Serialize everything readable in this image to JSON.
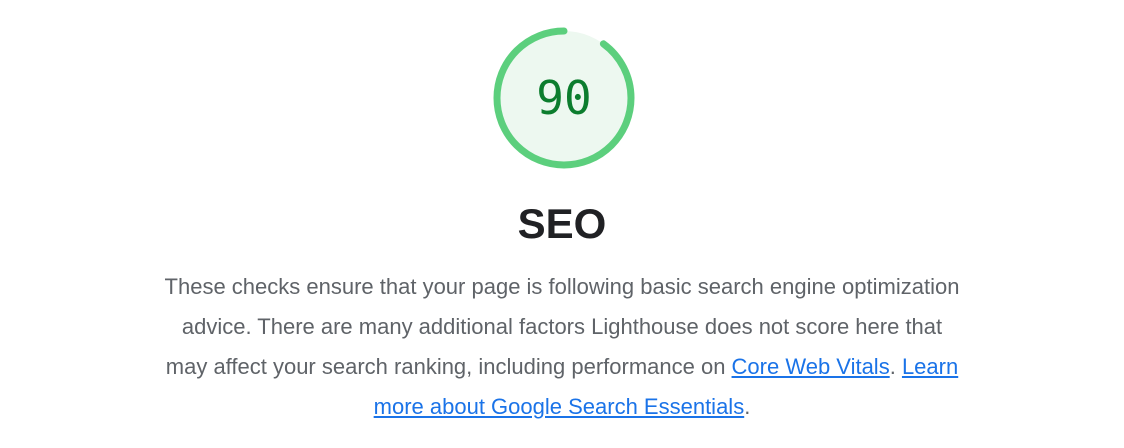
{
  "category": {
    "score": "90",
    "score_fraction": 0.9,
    "title": "SEO",
    "status": "pass"
  },
  "description": {
    "text_before": "These checks ensure that your page is following basic search engine optimization advice. There are many additional factors Lighthouse does not score here that may affect your search ranking, including performance on ",
    "link_vitals": "Core Web Vitals",
    "separator": ". ",
    "link_learn": "Learn more about Google Search Essentials",
    "text_after": "."
  },
  "colors": {
    "pass_arc": "#5ccf7d",
    "pass_fill": "#edf8f0",
    "pass_text": "#0c7d2e",
    "link": "#1a73e8",
    "heading": "#202124",
    "body_text": "#5f6368"
  }
}
